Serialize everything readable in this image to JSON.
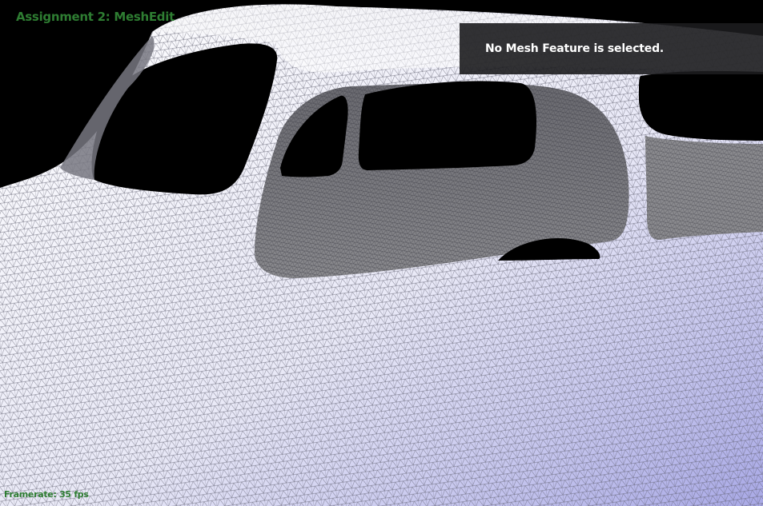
{
  "app": {
    "title": "Assignment 2: MeshEdit",
    "title_color": "#2e7d32"
  },
  "info_panel": {
    "message": "No Mesh Feature is selected.",
    "text_color": "#ffffff",
    "background": "#1c1c1e"
  },
  "status": {
    "framerate": "Framerate: 35 fps",
    "color": "#2e7d32"
  },
  "scene": {
    "background": "#000000",
    "surface_light": "#ffffff",
    "surface_tint": "#a9a9e6",
    "wire_color": "#5a5a6a"
  }
}
